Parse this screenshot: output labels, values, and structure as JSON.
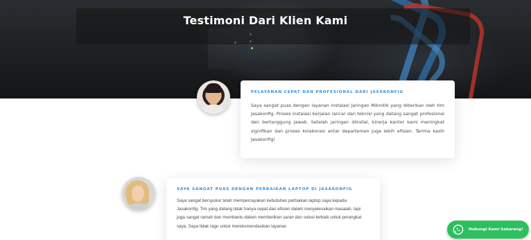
{
  "hero": {
    "title": "Testimoni Dari Klien Kami"
  },
  "testimonials": [
    {
      "heading": "PELAYANAN CEPAT DAN PROFESIONAL DARI JASAKONFIG",
      "text": "Saya sangat puas dengan layanan instalasi jaringan Mikrotik yang diberikan oleh tim Jasakonfig. Proses instalasi berjalan lancar dan teknisi yang datang sangat profesional dan bertanggung jawab. Setelah jaringan diinstal, kinerja kantor kami meningkat signifikan dan proses kolaborasi antar departemen juga lebih efisien. Terima kasih Jasakonfig!"
    },
    {
      "heading": "SAYA SANGAT PUAS DENGAN PERBAIKAN LAPTOP DI JASAKONFIG",
      "text": "Saya sangat bersyukur telah mempercayakan kebutuhan perbaikan laptop saya kepada Jasakonfig. Tim yang datang tidak hanya cepat dan efisien dalam menyelesaikan masalah, tapi juga sangat ramah dan membantu dalam memberikan saran dan solusi terbaik untuk perangkat saya. Saya tidak ragu untuk merekomendasikan layanan"
    }
  ],
  "whatsapp": {
    "label": "Hubungi Kami Sekarang!",
    "icon": "whatsapp-icon",
    "color": "#2dbf5e"
  },
  "colors": {
    "accent": "#2f8bd6",
    "hero_bg": "#1c1e21"
  }
}
